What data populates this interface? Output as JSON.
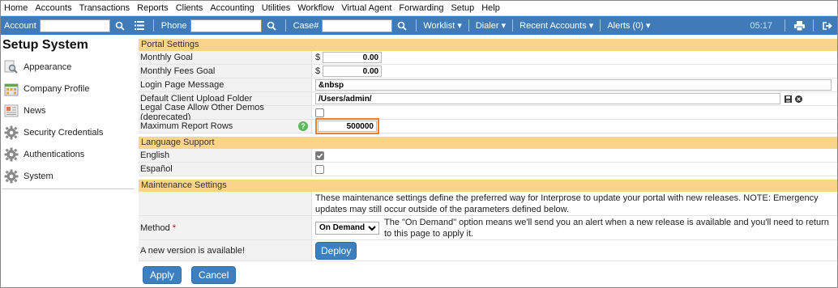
{
  "menu": [
    "Home",
    "Accounts",
    "Transactions",
    "Reports",
    "Clients",
    "Accounting",
    "Utilities",
    "Workflow",
    "Virtual Agent",
    "Forwarding",
    "Setup",
    "Help"
  ],
  "toolbar": {
    "account_label": "Account",
    "phone_label": "Phone",
    "case_label": "Case#",
    "worklist": "Worklist ▾",
    "dialer": "Dialer ▾",
    "recent_accounts": "Recent Accounts ▾",
    "alerts": "Alerts (0) ▾",
    "clock": "05:17"
  },
  "sidebar": {
    "title": "Setup System",
    "items": [
      {
        "label": "Appearance",
        "icon": "magnifier-document-icon"
      },
      {
        "label": "Company Profile",
        "icon": "building-icon"
      },
      {
        "label": "News",
        "icon": "newspaper-icon"
      },
      {
        "label": "Security Credentials",
        "icon": "gear-icon"
      },
      {
        "label": "Authentications",
        "icon": "gear-icon"
      },
      {
        "label": "System",
        "icon": "gear-icon"
      }
    ]
  },
  "portal": {
    "header": "Portal Settings",
    "monthly_goal_label": "Monthly Goal",
    "monthly_goal_prefix": "$",
    "monthly_goal_value": "0.00",
    "monthly_fees_label": "Monthly Fees Goal",
    "monthly_fees_prefix": "$",
    "monthly_fees_value": "0.00",
    "login_msg_label": "Login Page Message",
    "login_msg_value": "&nbsp",
    "upload_folder_label": "Default Client Upload Folder",
    "upload_folder_value": "/Users/admin/",
    "legal_case_label": "Legal Case Allow Other Demos (deprecated)",
    "max_rows_label": "Maximum Report Rows",
    "max_rows_value": "500000"
  },
  "language": {
    "header": "Language Support",
    "english_label": "English",
    "english_checked": true,
    "espanol_label": "Español",
    "espanol_checked": false
  },
  "maintenance": {
    "header": "Maintenance Settings",
    "description": "These maintenance settings define the preferred way for Interprose to update your portal with new releases. NOTE: Emergency updates may still occur outside of the parameters defined below.",
    "method_label": "Method",
    "required_marker": "*",
    "method_value": "On Demand",
    "method_help": "The \"On Demand\" option means we'll send you an alert when a new release is available and you'll need to return to this page to apply it.",
    "new_version_label": "A new version is available!",
    "deploy_label": "Deploy"
  },
  "actions": {
    "apply_label": "Apply",
    "cancel_label": "Cancel"
  }
}
